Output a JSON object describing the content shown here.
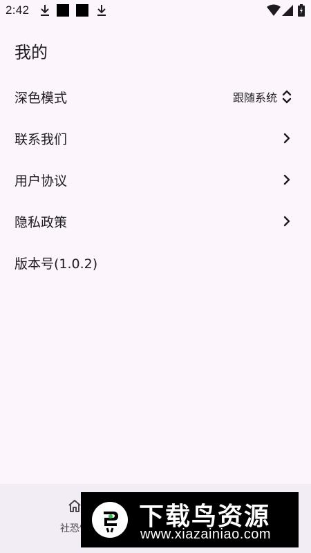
{
  "status_bar": {
    "time": "2:42"
  },
  "header": {
    "title": "我的"
  },
  "settings": [
    {
      "label": "深色模式",
      "value": "跟随系统",
      "icon": "chevron-up-down-icon"
    },
    {
      "label": "联系我们",
      "icon": "chevron-right-icon"
    },
    {
      "label": "用户协议",
      "icon": "chevron-right-icon"
    },
    {
      "label": "隐私政策",
      "icon": "chevron-right-icon"
    },
    {
      "label": "版本号(1.0.2)"
    }
  ],
  "bottom_nav": {
    "items": [
      {
        "label": "社恐快",
        "icon": "home-icon"
      }
    ]
  },
  "watermark": {
    "title": "下载鸟资源",
    "url": "www.xiazainiao.com"
  },
  "colors": {
    "background": "#fcf6fc",
    "nav_background": "#f2ecf4",
    "text": "#1d1b20",
    "watermark_bg": "#000000",
    "watermark_dot": "#2ec24a"
  }
}
